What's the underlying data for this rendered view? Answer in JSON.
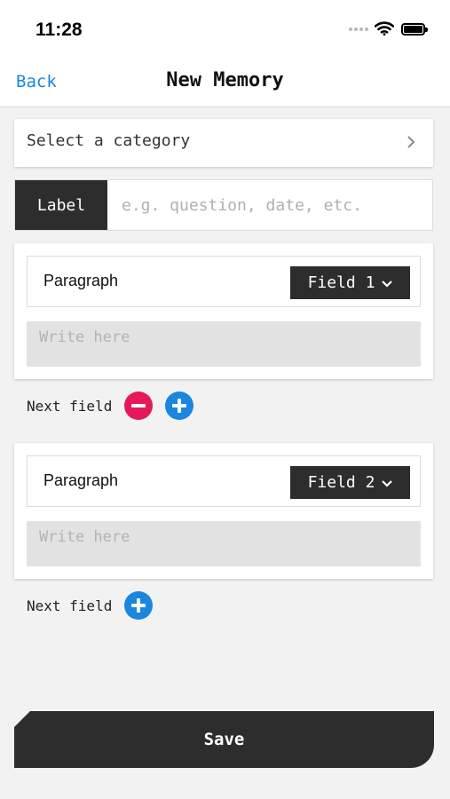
{
  "status_bar": {
    "time": "11:28"
  },
  "nav": {
    "back_label": "Back",
    "title": "New Memory"
  },
  "category": {
    "label": "Select a category"
  },
  "label_row": {
    "tag": "Label",
    "placeholder": "e.g. question, date, etc.",
    "value": ""
  },
  "fields": [
    {
      "type_label": "Paragraph",
      "field_label": "Field 1",
      "placeholder": "Write here",
      "value": ""
    },
    {
      "type_label": "Paragraph",
      "field_label": "Field 2",
      "placeholder": "Write here",
      "value": ""
    }
  ],
  "next_field": {
    "label": "Next field"
  },
  "save_label": "Save",
  "colors": {
    "accent_blue": "#1a86e0",
    "remove_red": "#e5195a",
    "dark": "#2d2d2d"
  },
  "icons": [
    "signal-dots-icon",
    "wifi-icon",
    "battery-icon",
    "chevron-right-icon",
    "chevron-down-icon",
    "minus-circle-icon",
    "plus-circle-icon"
  ]
}
